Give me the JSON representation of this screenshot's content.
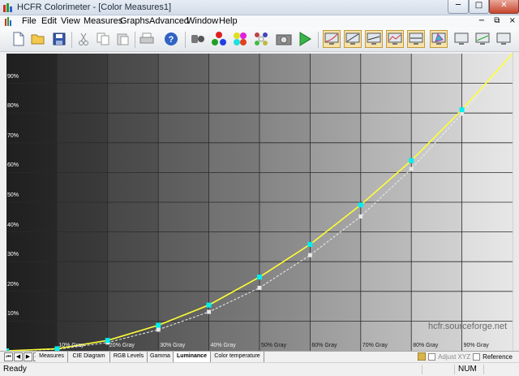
{
  "window": {
    "title": "HCFR Colorimeter - [Color Measures1]",
    "minimize_glyph": "─",
    "maximize_glyph": "□",
    "close_glyph": "✕"
  },
  "menu": {
    "items": [
      "File",
      "Edit",
      "View",
      "Measures",
      "Graphs",
      "Advanced",
      "Window",
      "Help"
    ],
    "mdi_controls": [
      "−",
      "⧉",
      "×"
    ]
  },
  "toolbar": {
    "buttons": [
      "new-document-icon",
      "open-folder-icon",
      "save-icon",
      "cut-icon",
      "copy-icon",
      "paste-icon",
      "print-icon",
      "help-icon",
      "sensor-icon",
      "rgb-balls-icon",
      "color-spheres-icon",
      "color-grid-icon",
      "camera-icon",
      "play-icon",
      "graph-view-1-icon",
      "graph-view-2-icon",
      "graph-view-3-icon",
      "graph-view-4-icon",
      "graph-view-5-icon",
      "cie-view-icon",
      "monitor-view-1-icon",
      "monitor-view-2-icon",
      "monitor-view-3-icon"
    ]
  },
  "plot": {
    "y_tick_labels": [
      "90%",
      "80%",
      "70%",
      "60%",
      "50%",
      "40%",
      "30%",
      "20%",
      "10%"
    ],
    "x_tick_labels": [
      "10% Gray",
      "20% Gray",
      "30% Gray",
      "40% Gray",
      "50% Gray",
      "60% Gray",
      "70% Gray",
      "80% Gray",
      "90% Gray"
    ],
    "watermark": "hcfr.sourceforge.net",
    "series": {
      "measured_color": "#ffff33",
      "measured_marker_color": "#00f0f0",
      "reference_color": "#f0f0f0",
      "measured_y": [
        0,
        0.7,
        3.5,
        8.6,
        15.4,
        24.8,
        35.8,
        49.1,
        64.0,
        81.1,
        100
      ],
      "reference_y": [
        0,
        0.5,
        2.8,
        7.1,
        13.1,
        21.2,
        32.2,
        45.2,
        61.2,
        79.8,
        100
      ]
    }
  },
  "tabs": {
    "nav": [
      "⏮",
      "◀",
      "▶",
      "⏭"
    ],
    "items": [
      "Measures",
      "CIE Diagram",
      "RGB Levels",
      "Gamma",
      "Luminance",
      "Color temperature"
    ],
    "active_index": 4,
    "adjust_xyz": "Adjust XYZ",
    "reference": "Reference"
  },
  "status": {
    "text": "Ready",
    "num": "NUM"
  }
}
